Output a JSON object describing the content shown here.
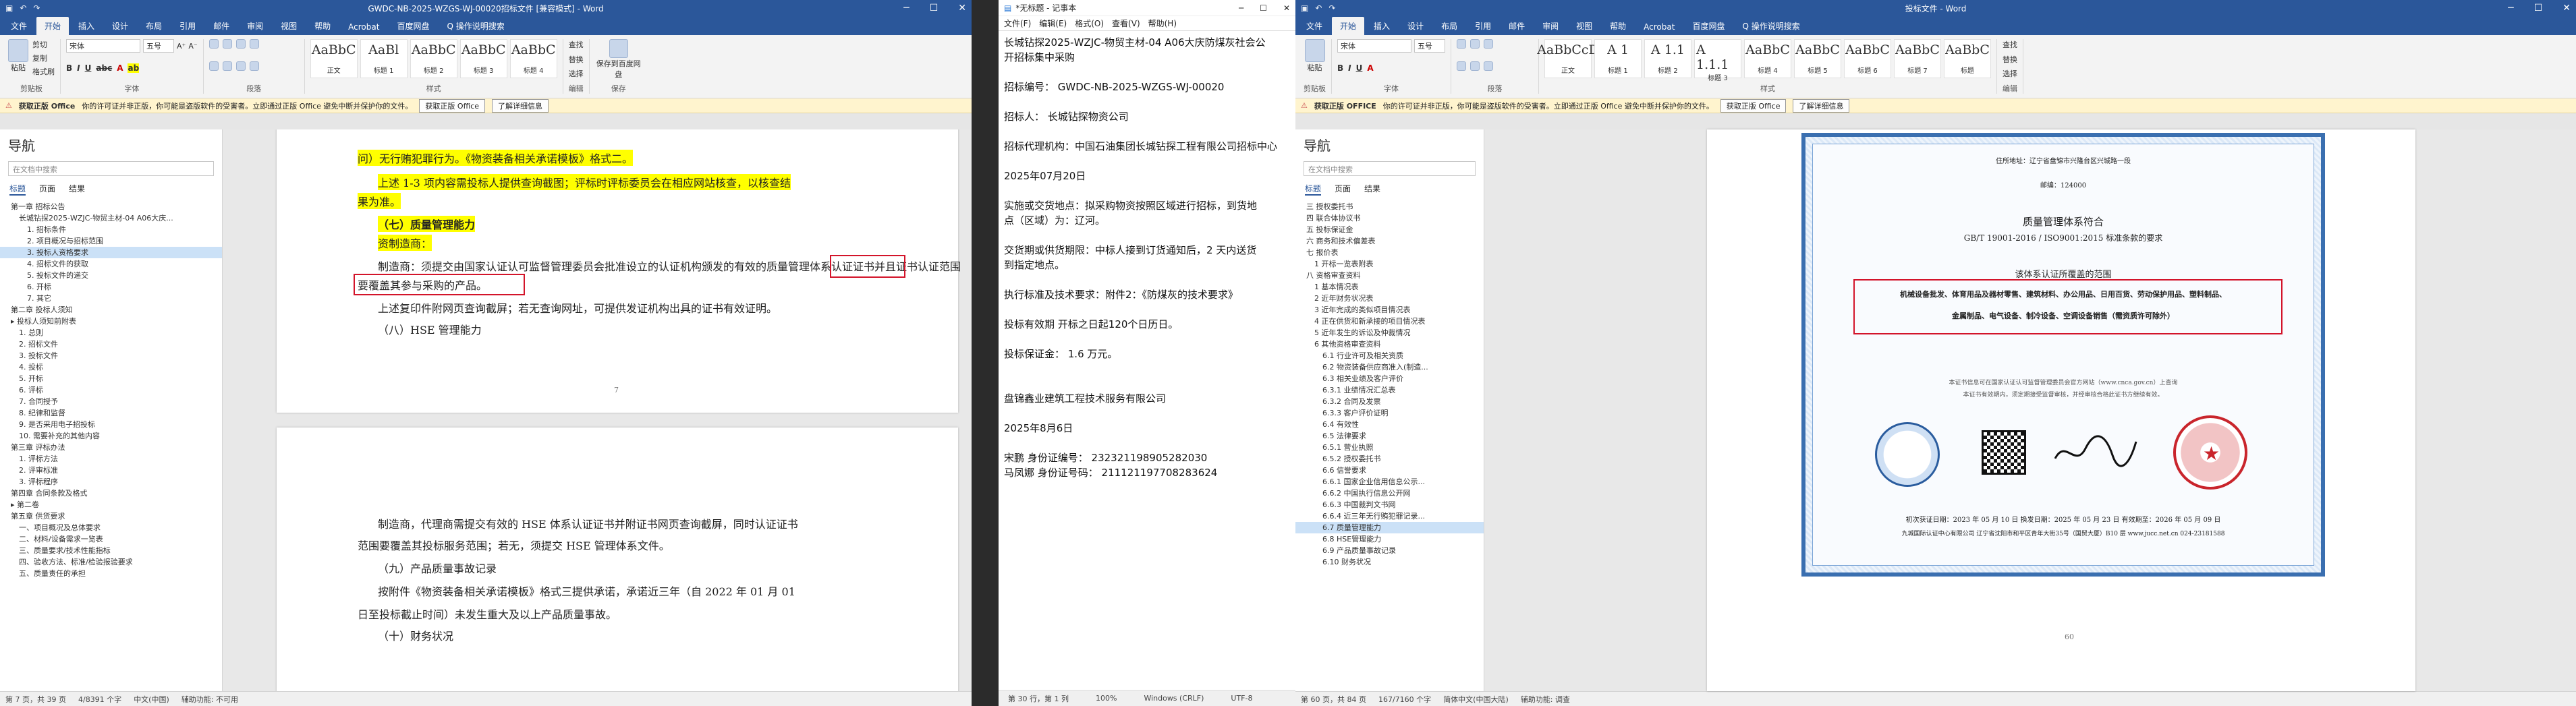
{
  "window1": {
    "title": "GWDC-NB-2025-WZGS-WJ-00020招标文件 [兼容模式] - Word",
    "tabs": [
      "文件",
      "开始",
      "插入",
      "设计",
      "布局",
      "引用",
      "邮件",
      "审阅",
      "视图",
      "帮助",
      "Acrobat",
      "百度网盘",
      "Q 操作说明搜索"
    ],
    "ribbon": {
      "paste": "粘贴",
      "clip_items": [
        "剪切",
        "复制",
        "格式刷"
      ],
      "clipboard": "剪贴板",
      "font_name": "宋体",
      "font_size": "五号",
      "font_group": "字体",
      "para_group": "段落",
      "styles": [
        {
          "preview": "AaBbC",
          "name": "正文"
        },
        {
          "preview": "AaBl",
          "name": "标题 1"
        },
        {
          "preview": "AaBbC",
          "name": "标题 2"
        },
        {
          "preview": "AaBbC",
          "name": "标题 3"
        },
        {
          "preview": "AaBbC",
          "name": "标题 4"
        }
      ],
      "styles_group": "样式",
      "edit_items": [
        "查找",
        "替换",
        "选择"
      ],
      "edit_group": "编辑",
      "save_baidu": "保存到百度网盘",
      "save_group": "保存"
    },
    "infobar": {
      "title": "获取正版 Office",
      "text": "你的许可证并非正版，你可能是盗版软件的受害者。立即通过正版 Office 避免中断并保护你的文件。",
      "btn1": "获取正版 Office",
      "btn2": "了解详细信息"
    },
    "nav": {
      "title": "导航",
      "search_placeholder": "在文档中搜索",
      "tabs": [
        "标题",
        "页面",
        "结果"
      ],
      "items": [
        {
          "t": "第一章 招标公告",
          "lv": 1
        },
        {
          "t": "长城钻探2025-WZJC-物贸主材-04 A06大庆...",
          "lv": 2
        },
        {
          "t": "1. 招标条件",
          "lv": 3
        },
        {
          "t": "2. 项目概况与招标范围",
          "lv": 3
        },
        {
          "t": "3. 投标人资格要求",
          "lv": 3,
          "sel": true
        },
        {
          "t": "4. 招标文件的获取",
          "lv": 3
        },
        {
          "t": "5. 投标文件的递交",
          "lv": 3
        },
        {
          "t": "6. 开标",
          "lv": 3
        },
        {
          "t": "7. 其它",
          "lv": 3
        },
        {
          "t": "第二章 投标人须知",
          "lv": 1
        },
        {
          "t": "▸ 投标人须知前附表",
          "lv": 1
        },
        {
          "t": "1. 总则",
          "lv": 2
        },
        {
          "t": "2. 招标文件",
          "lv": 2
        },
        {
          "t": "3. 投标文件",
          "lv": 2
        },
        {
          "t": "4. 投标",
          "lv": 2
        },
        {
          "t": "5. 开标",
          "lv": 2
        },
        {
          "t": "6. 评标",
          "lv": 2
        },
        {
          "t": "7. 合同授予",
          "lv": 2
        },
        {
          "t": "8. 纪律和监督",
          "lv": 2
        },
        {
          "t": "9. 是否采用电子招投标",
          "lv": 2
        },
        {
          "t": "10. 需要补充的其他内容",
          "lv": 2
        },
        {
          "t": "第三章 评标办法",
          "lv": 1
        },
        {
          "t": "1. 评标方法",
          "lv": 2
        },
        {
          "t": "2. 评审标准",
          "lv": 2
        },
        {
          "t": "3. 评标程序",
          "lv": 2
        },
        {
          "t": "第四章 合同条款及格式",
          "lv": 1
        },
        {
          "t": "▸ 第二卷",
          "lv": 1
        },
        {
          "t": "第五章 供货要求",
          "lv": 1
        },
        {
          "t": "一、项目概况及总体要求",
          "lv": 2
        },
        {
          "t": "二、材料/设备需求一览表",
          "lv": 2
        },
        {
          "t": "三、质量要求/技术性能指标",
          "lv": 2
        },
        {
          "t": "四、验收方法、标准/检验报验要求",
          "lv": 2
        },
        {
          "t": "五、质量责任的承担",
          "lv": 2
        }
      ]
    },
    "page1_lines": [
      "问）无行贿犯罪行为。《物资装备相关承诺模板》格式二。",
      "上述 1-3 项内容需投标人提供查询截图；评标时评标委员会在相应网站核查，以核查结",
      "果为准。",
      "（七）质量管理能力",
      "资制造商：",
      "制造商：须提交由国家认证认可监督管理委员会批准设立的认证机构颁发的有效的质量管理体系认证证书并且证书认证范围",
      "要覆盖其参与采购的产品。",
      "上述复印件附网页查询截屏；若无查询网址，可提供发证机构出具的证书有效证明。",
      "（八）HSE 管理能力"
    ],
    "page_num_1": "7",
    "page2_lines": [
      "制造商，代理商需提交有效的 HSE 体系认证证书并附证书网页查询截屏，同时认证证书",
      "范围要覆盖其投标服务范围；若无，须提交 HSE 管理体系文件。",
      "（九）产品质量事故记录",
      "按附件《物资装备相关承诺模板》格式三提供承诺，承诺近三年（自 2022 年 01 月 01",
      "日至投标截止时间）未发生重大及以上产品质量事故。",
      "（十）财务状况"
    ],
    "status": [
      "第 7 页，共 39 页",
      "4/8391 个字",
      "中文(中国)",
      "辅助功能: 不可用"
    ]
  },
  "notepad": {
    "title": "*无标题 - 记事本",
    "menu": [
      "文件(F)",
      "编辑(E)",
      "格式(O)",
      "查看(V)",
      "帮助(H)"
    ],
    "lines": [
      "长城钻探2025-WZJC-物贸主材-04 A06大庆防煤灰社会公",
      "开招标集中采购",
      "",
      "招标编号：  GWDC-NB-2025-WZGS-WJ-00020",
      "",
      "招标人：   长城钻探物资公司",
      "",
      "招标代理机构：中国石油集团长城钻探工程有限公司招标中心",
      "",
      "2025年07月20日",
      "",
      "实施或交货地点：拟采购物资按照区域进行招标，到货地",
      "点（区域）为：辽河。",
      "",
      "交货期或供货期限：中标人接到订货通知后，2 天内送货",
      "到指定地点。",
      "",
      "执行标准及技术要求：附件2：《防煤灰的技术要求》",
      "",
      "投标有效期  开标之日起120个日历日。",
      "",
      "投标保证金：   1.6  万元。",
      "",
      "",
      "盘锦鑫业建筑工程技术服务有限公司",
      "",
      "2025年8月6日",
      "",
      "宋鹏     身份证编号：  232321198905282030",
      "马凤娜  身份证号码：  211121197708283624"
    ],
    "status": [
      "第 30 行，第 1 列",
      "100%",
      "Windows (CRLF)",
      "UTF-8"
    ]
  },
  "window3": {
    "title": "投标文件 - Word",
    "tabs": [
      "文件",
      "开始",
      "插入",
      "设计",
      "布局",
      "引用",
      "邮件",
      "审阅",
      "视图",
      "帮助",
      "Acrobat",
      "百度网盘",
      "Q 操作说明搜索"
    ],
    "font_name": "宋体",
    "font_size": "五号",
    "styles": [
      {
        "preview": "AaBbCcD",
        "name": "正文"
      },
      {
        "preview": "A 1",
        "name": "标题 1"
      },
      {
        "preview": "A 1.1",
        "name": "标题 2"
      },
      {
        "preview": "A 1.1.1",
        "name": "标题 3"
      },
      {
        "preview": "AaBbC",
        "name": "标题 4"
      },
      {
        "preview": "AaBbC",
        "name": "标题 5"
      },
      {
        "preview": "AaBbC",
        "name": "标题 6"
      },
      {
        "preview": "AaBbC",
        "name": "标题 7"
      },
      {
        "preview": "AaBbC",
        "name": "标题"
      }
    ],
    "infobar_title": "获取正版 OFFICE",
    "nav_items": [
      {
        "t": "三 授权委托书",
        "lv": 1
      },
      {
        "t": "四 联合体协议书",
        "lv": 1
      },
      {
        "t": "五 投标保证金",
        "lv": 1
      },
      {
        "t": "六 商务和技术偏差表",
        "lv": 1
      },
      {
        "t": "七 报价表",
        "lv": 1
      },
      {
        "t": "1 开标一览表附表",
        "lv": 2
      },
      {
        "t": "八 资格审查资料",
        "lv": 1
      },
      {
        "t": "1 基本情况表",
        "lv": 2
      },
      {
        "t": "2 近年财务状况表",
        "lv": 2
      },
      {
        "t": "3 近年完成的类似项目情况表",
        "lv": 2
      },
      {
        "t": "4 正在供货和新承接的项目情况表",
        "lv": 2
      },
      {
        "t": "5 近年发生的诉讼及仲裁情况",
        "lv": 2
      },
      {
        "t": "6 其他资格审查资料",
        "lv": 2
      },
      {
        "t": "6.1 行业许可及相关资质",
        "lv": 3
      },
      {
        "t": "6.2 物资装备供应商准入(制造...",
        "lv": 3
      },
      {
        "t": "6.3 相关业绩及客户评价",
        "lv": 3
      },
      {
        "t": "6.3.1 业绩情况汇总表",
        "lv": 3
      },
      {
        "t": "6.3.2 合同及发票",
        "lv": 3
      },
      {
        "t": "6.3.3 客户评价证明",
        "lv": 3
      },
      {
        "t": "6.4 有效性",
        "lv": 3
      },
      {
        "t": "6.5 法律要求",
        "lv": 3
      },
      {
        "t": "6.5.1 营业执照",
        "lv": 3
      },
      {
        "t": "6.5.2 授权委托书",
        "lv": 3
      },
      {
        "t": "6.6 信誉要求",
        "lv": 3
      },
      {
        "t": "6.6.1 国家企业信用信息公示...",
        "lv": 3
      },
      {
        "t": "6.6.2 中国执行信息公开网",
        "lv": 3
      },
      {
        "t": "6.6.3 中国裁判文书网",
        "lv": 3
      },
      {
        "t": "6.6.4 近三年无行贿犯罪记录...",
        "lv": 3
      },
      {
        "t": "6.7 质量管理能力",
        "lv": 3,
        "sel": true
      },
      {
        "t": "6.8 HSE管理能力",
        "lv": 3
      },
      {
        "t": "6.9 产品质量事故记录",
        "lv": 3
      },
      {
        "t": "6.10 财务状况",
        "lv": 3
      }
    ],
    "cert": {
      "addr": "住所地址：辽宁省盘锦市兴隆台区兴城路一段",
      "zip": "邮编：124000",
      "heading": "质量管理体系符合",
      "std": "GB/T 19001-2016 / ISO9001:2015 标准条款的要求",
      "scope_title": "该体系认证所覆盖的范围",
      "scope1": "机械设备批发、体育用品及器材零售、建筑材料、办公用品、日用百货、劳动保护用品、塑料制品、",
      "scope2": "金属制品、电气设备、制冷设备、空调设备销售（需资质许可除外）",
      "note1": "本证书信息可在国家认证认可监督管理委员会官方网站（www.cnca.gov.cn）上查询",
      "note2": "本证书有效期内，须定期接受监督审核，并经审核合格此证书方继续有效。",
      "dates": "初次获证日期：2023 年 05 月 10 日    换发日期：2025 年 05 月 23 日    有效期至：2026 年 05 月 09 日",
      "issuer": "九城国际认证中心有限公司 辽宁省沈阳市和平区青年大街35号（国贸大厦）B10 层 www.jucc.net.cn 024-23181588",
      "pagenum": "60"
    },
    "status": [
      "第 60 页，共 84 页",
      "167/7160 个字",
      "简体中文(中国大陆)",
      "辅助功能: 调查"
    ]
  },
  "colors": {
    "word_blue": "#2b579a",
    "highlight": "#ffff00",
    "red_box": "#d3142a",
    "info_bar": "#fff4ce"
  }
}
